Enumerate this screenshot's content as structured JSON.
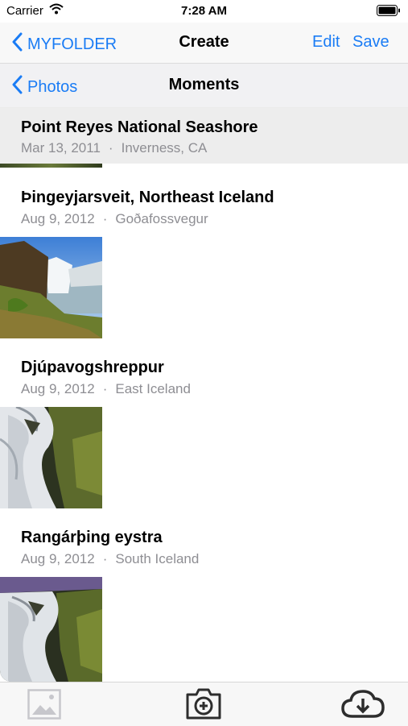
{
  "status_bar": {
    "carrier": "Carrier",
    "time": "7:28 AM"
  },
  "nav_bar": {
    "back_label": "MYFOLDER",
    "title": "Create",
    "edit_label": "Edit",
    "save_label": "Save"
  },
  "sub_bar": {
    "back_label": "Photos",
    "title": "Moments"
  },
  "moments": [
    {
      "place": "Point Reyes National Seashore",
      "date": "Mar 13, 2011",
      "location": "Inverness, CA"
    },
    {
      "place": "Þingeyjarsveit, Northeast Iceland",
      "date": "Aug 9, 2012",
      "location": "Goðafossvegur"
    },
    {
      "place": "Djúpavogshreppur",
      "date": "Aug 9, 2012",
      "location": "East Iceland"
    },
    {
      "place": "Rangárþing eystra",
      "date": "Aug 9, 2012",
      "location": "South Iceland"
    }
  ],
  "separator": "·",
  "tab_bar": {
    "icons": [
      "photo-library-icon",
      "camera-icon",
      "cloud-download-icon"
    ]
  },
  "colors": {
    "accent": "#1a7cf5",
    "secondary_text": "#8e8e93"
  }
}
